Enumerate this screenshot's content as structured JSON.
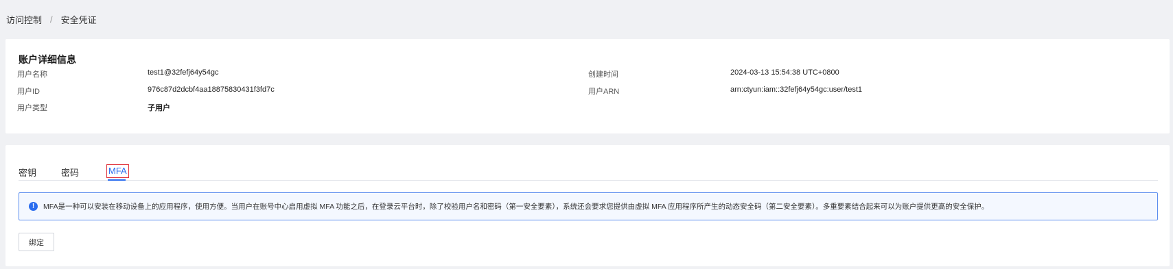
{
  "breadcrumb": {
    "parent": "访问控制",
    "separator": "/",
    "current": "安全凭证"
  },
  "detail": {
    "title": "账户详细信息",
    "fields": {
      "username": {
        "label": "用户名称",
        "value": "test1@32fefj64y54gc"
      },
      "user_id": {
        "label": "用户ID",
        "value": "976c87d2dcbf4aa18875830431f3fd7c"
      },
      "user_type": {
        "label": "用户类型",
        "value": "子用户"
      },
      "created": {
        "label": "创建时间",
        "value": "2024-03-13 15:54:38 UTC+0800"
      },
      "arn": {
        "label": "用户ARN",
        "value": "arn:ctyun:iam::32fefj64y54gc:user/test1"
      }
    }
  },
  "tabs": [
    {
      "label": "密钥"
    },
    {
      "label": "密码"
    },
    {
      "label": "MFA",
      "active": true
    }
  ],
  "mfa": {
    "info_icon": "info-icon",
    "info_text": "MFA是一种可以安装在移动设备上的应用程序，使用方便。当用户在账号中心启用虚拟 MFA 功能之后，在登录云平台时，除了校验用户名和密码（第一安全要素），系统还会要求您提供由虚拟 MFA 应用程序所产生的动态安全码（第二安全要素）。多重要素结合起来可以为账户提供更高的安全保护。",
    "bind_button": "绑定"
  },
  "colors": {
    "accent": "#2b6def",
    "background": "#f0f1f4",
    "highlight_border": "#e0313a"
  }
}
